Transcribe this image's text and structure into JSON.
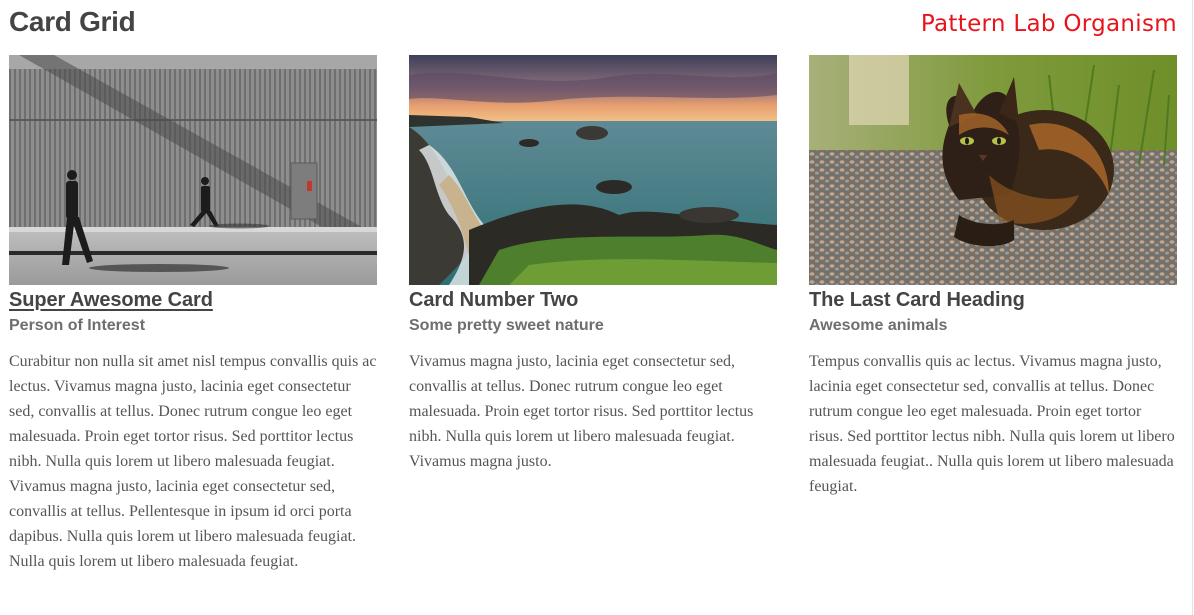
{
  "header": {
    "title": "Card Grid",
    "organism_label": "Pattern Lab Organism"
  },
  "cards": [
    {
      "heading": "Super Awesome Card",
      "subheading": "Person of Interest",
      "body": "Curabitur non nulla sit amet nisl tempus convallis quis ac lectus. Vivamus magna justo, lacinia eget consectetur sed, convallis at tellus. Donec rutrum congue leo eget malesuada. Proin eget tortor risus. Sed porttitor lectus nibh. Nulla quis lorem ut libero malesuada feugiat. Vivamus magna justo, lacinia eget consectetur sed, convallis at tellus. Pellentesque in ipsum id orci porta dapibus. Nulla quis lorem ut libero malesuada feugiat. Nulla quis lorem ut libero malesuada feugiat.",
      "heading_is_link": true
    },
    {
      "heading": "Card Number Two",
      "subheading": "Some pretty sweet nature",
      "body": "Vivamus magna justo, lacinia eget consectetur sed, convallis at tellus. Donec rutrum congue leo eget malesuada. Proin eget tortor risus. Sed porttitor lectus nibh. Nulla quis lorem ut libero malesuada feugiat. Vivamus magna justo.",
      "heading_is_link": false
    },
    {
      "heading": "The Last Card Heading",
      "subheading": "Awesome animals",
      "body": "Tempus convallis quis ac lectus. Vivamus magna justo, lacinia eget consectetur sed, convallis at tellus. Donec rutrum congue leo eget malesuada. Proin eget tortor risus. Sed porttitor lectus nibh. Nulla quis lorem ut libero malesuada feugiat.. Nulla quis lorem ut libero malesuada feugiat.",
      "heading_is_link": false
    }
  ],
  "colors": {
    "organism_label": "#e8141c",
    "heading": "#444444",
    "subheading": "#6e6e6e",
    "body_text": "#555555"
  }
}
